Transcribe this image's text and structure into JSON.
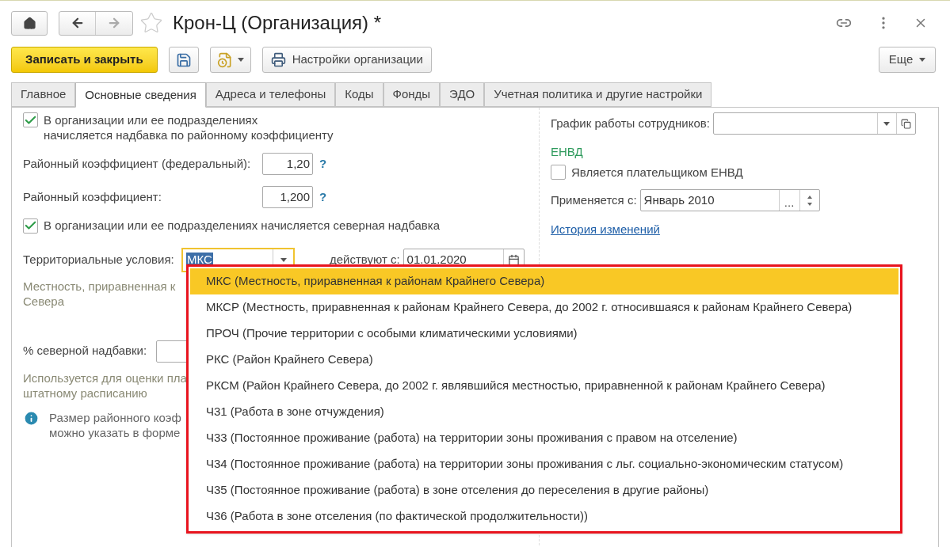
{
  "header": {
    "title": "Крон-Ц (Организация) *",
    "favorite": false
  },
  "toolbar": {
    "save_close": "Записать и закрыть",
    "settings": "Настройки организации",
    "more": "Еще"
  },
  "tabs": [
    {
      "label": "Главное",
      "selected": false
    },
    {
      "label": "Основные сведения",
      "selected": true
    },
    {
      "label": "Адреса и телефоны",
      "selected": false
    },
    {
      "label": "Коды",
      "selected": false
    },
    {
      "label": "Фонды",
      "selected": false
    },
    {
      "label": "ЭДО",
      "selected": false
    },
    {
      "label": "Учетная политика и другие настройки",
      "selected": false
    }
  ],
  "left": {
    "regional_checkbox": {
      "lines": [
        "В организации или ее подразделениях",
        "начисляется надбавка по районному коэффициенту"
      ],
      "checked": true
    },
    "coefficients": [
      {
        "label": "Районный коэффициент (федеральный):",
        "value": "1,20",
        "help": "?"
      },
      {
        "label": "Районный коэффициент:",
        "value": "1,200",
        "help": "?"
      }
    ],
    "north_checkbox": {
      "lines": [
        "В организации или ее подразделениях начисляется северная надбавка"
      ],
      "checked": true
    },
    "territorial": {
      "label": "Территориальные условия:",
      "value": "МКС",
      "date_label": "действуют с:",
      "date": "01.01.2020"
    },
    "territory_note": [
      "Местность, приравненная к",
      "Севера"
    ],
    "north_percent": {
      "label": "% северной надбавки:"
    },
    "usage_note": [
      "Используется для оценки пла",
      "штатному расписанию"
    ],
    "info_note": [
      "Размер районного коэф",
      "можно указать в форме"
    ]
  },
  "right": {
    "schedule": {
      "label": "График работы сотрудников:"
    },
    "envd_heading": "ЕНВД",
    "envd_checkbox": {
      "label": "Является плательщиком ЕНВД",
      "checked": false
    },
    "applies": {
      "label": "Применяется с:",
      "value": "Январь 2010",
      "choose": "..."
    },
    "history_link": "История изменений"
  },
  "dropdown": [
    {
      "label": "МКС (Местность, приравненная к районам Крайнего Севера)",
      "selected": true
    },
    {
      "label": "МКСР (Местность, приравненная к районам Крайнего Севера, до 2002 г. относившаяся к районам Крайнего Севера)",
      "selected": false
    },
    {
      "label": "ПРОЧ (Прочие территории с особыми климатическими условиями)",
      "selected": false
    },
    {
      "label": "РКС (Район Крайнего Севера)",
      "selected": false
    },
    {
      "label": "РКСМ (Район Крайнего Севера, до 2002 г. являвшийся местностью, приравненной к районам Крайнего Севера)",
      "selected": false
    },
    {
      "label": "Ч31 (Работа в зоне отчуждения)",
      "selected": false
    },
    {
      "label": "Ч33 (Постоянное проживание (работа) на территории зоны проживания с правом на отселение)",
      "selected": false
    },
    {
      "label": "Ч34 (Постоянное проживание (работа) на территории зоны проживания с льг. социально-экономическим статусом)",
      "selected": false
    },
    {
      "label": "Ч35 (Постоянное проживание (работа) в зоне отселения до переселения в другие районы)",
      "selected": false
    },
    {
      "label": "Ч36 (Работа в зоне отселения (по фактической продолжительности))",
      "selected": false
    }
  ]
}
